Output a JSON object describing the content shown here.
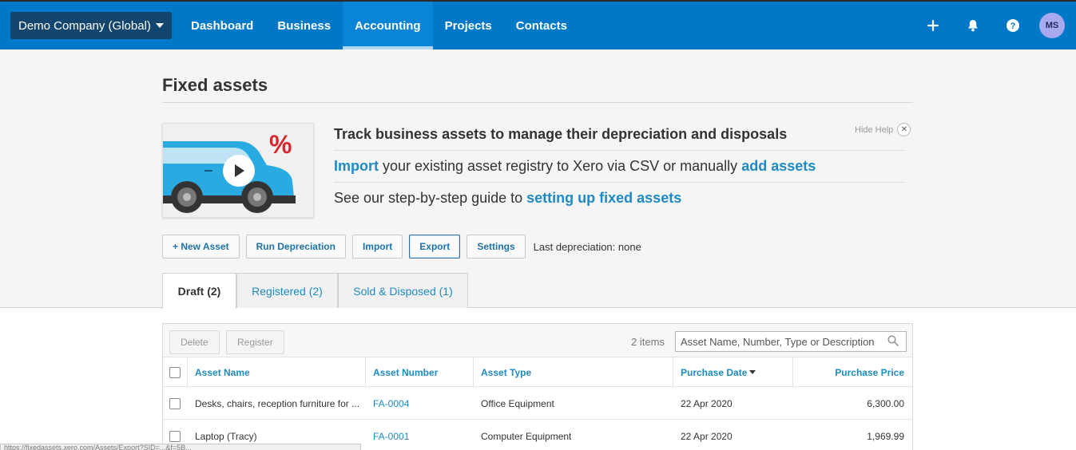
{
  "header": {
    "org_name": "Demo Company (Global)",
    "nav": [
      {
        "label": "Dashboard"
      },
      {
        "label": "Business"
      },
      {
        "label": "Accounting"
      },
      {
        "label": "Projects"
      },
      {
        "label": "Contacts"
      }
    ],
    "active_nav": "Accounting",
    "avatar_initials": "MS"
  },
  "page": {
    "title": "Fixed assets"
  },
  "help": {
    "headline": "Track business assets to manage their depreciation and disposals",
    "line2_link1": "Import",
    "line2_text": " your existing asset registry to Xero via CSV or manually ",
    "line2_link2": "add assets",
    "line3_text": "See our step-by-step guide to ",
    "line3_link": "setting up fixed assets",
    "hide_label": "Hide Help",
    "thumb_symbol": "%"
  },
  "toolbar": {
    "new_asset": "+ New Asset",
    "run_depreciation": "Run Depreciation",
    "import": "Import",
    "export": "Export",
    "settings": "Settings",
    "last_depreciation": "Last depreciation: none"
  },
  "tabs": [
    {
      "label": "Draft (2)"
    },
    {
      "label": "Registered (2)"
    },
    {
      "label": "Sold & Disposed (1)"
    }
  ],
  "active_tab": "Draft (2)",
  "table": {
    "delete_label": "Delete",
    "register_label": "Register",
    "items_count": "2 items",
    "search_placeholder": "Asset Name, Number, Type or Description",
    "columns": {
      "name": "Asset Name",
      "number": "Asset Number",
      "type": "Asset Type",
      "date": "Purchase Date",
      "price": "Purchase Price"
    },
    "rows": [
      {
        "name": "Desks, chairs, reception furniture for ...",
        "number": "FA-0004",
        "type": "Office Equipment",
        "date": "22 Apr 2020",
        "price": "6,300.00"
      },
      {
        "name": "Laptop (Tracy)",
        "number": "FA-0001",
        "type": "Computer Equipment",
        "date": "22 Apr 2020",
        "price": "1,969.99"
      }
    ]
  },
  "colors": {
    "topbar": "#0078c8",
    "link": "#1e8ac2",
    "org_bg": "#13466f"
  },
  "status_url": "https://fixedassets.xero.com/Assets/Export?SID=...&f=5B..."
}
